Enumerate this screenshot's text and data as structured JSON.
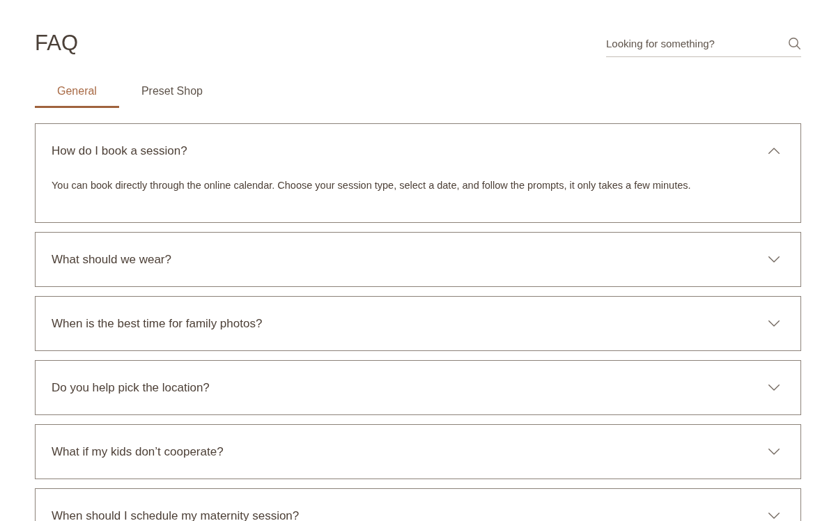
{
  "page": {
    "title": "FAQ"
  },
  "search": {
    "placeholder": "Looking for something?"
  },
  "tabs": [
    {
      "label": "General",
      "selected": true
    },
    {
      "label": "Preset Shop",
      "selected": false
    }
  ],
  "faq": [
    {
      "question": "How do I book a session?",
      "answer": "You can book directly through the online calendar. Choose your session type, select a date, and follow the prompts, it only takes a few minutes.",
      "expanded": true
    },
    {
      "question": "What should we wear?",
      "expanded": false
    },
    {
      "question": "When is the best time for family photos?",
      "expanded": false
    },
    {
      "question": "Do you help pick the location?",
      "expanded": false
    },
    {
      "question": "What if my kids don’t cooperate?",
      "expanded": false
    },
    {
      "question": "When should I schedule my maternity session?",
      "expanded": false
    }
  ]
}
